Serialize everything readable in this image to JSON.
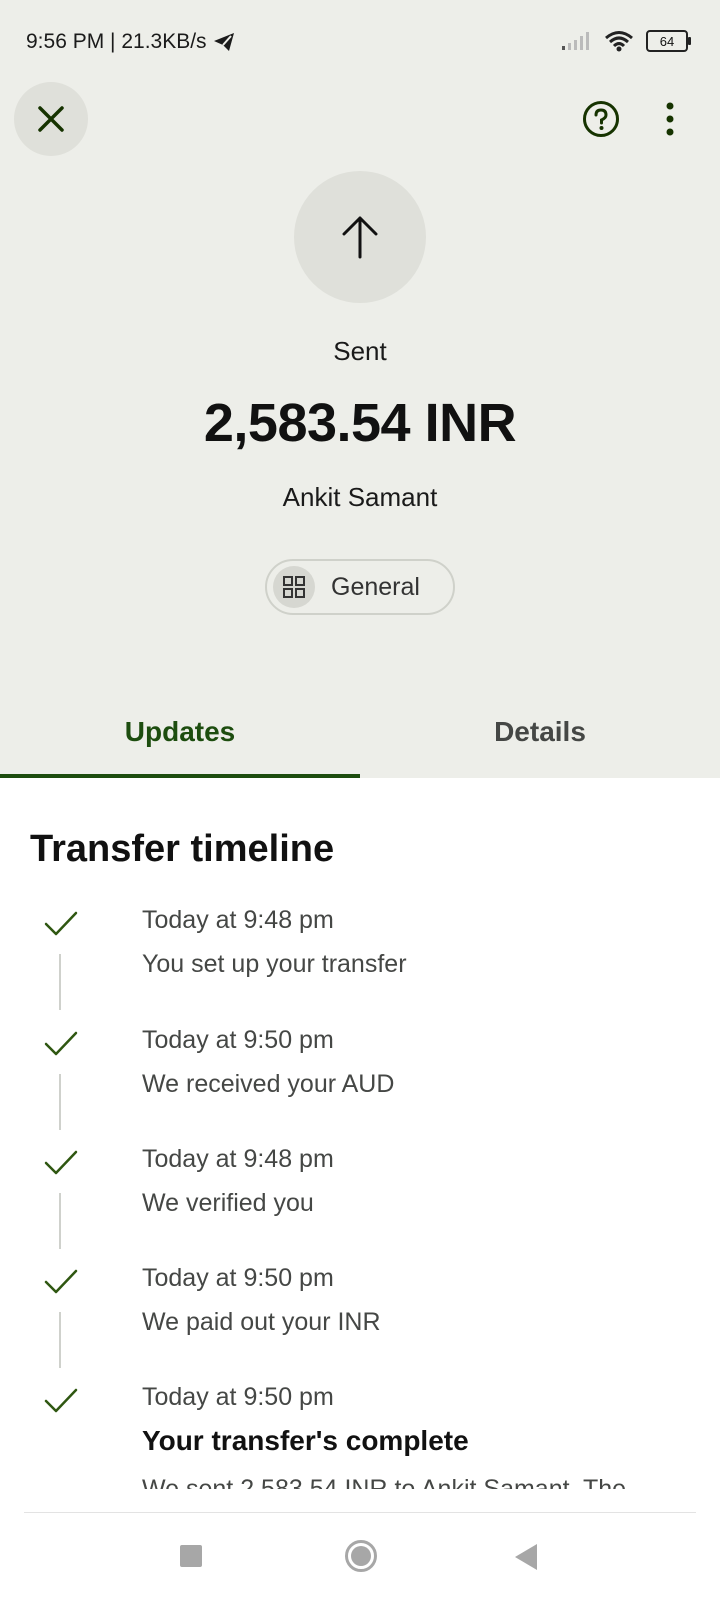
{
  "status_bar": {
    "time_speed": "9:56 PM | 21.3KB/s",
    "battery": "64",
    "icons": [
      "telegram-icon",
      "signal-icon",
      "wifi-icon",
      "battery-icon"
    ]
  },
  "header": {
    "icons": [
      "close-icon",
      "help-icon",
      "more-vert-icon"
    ]
  },
  "transfer": {
    "direction_icon": "arrow-up-icon",
    "status": "Sent",
    "amount": "2,583.54 INR",
    "recipient": "Ankit Samant",
    "category": "General",
    "category_icon": "grid-icon"
  },
  "tabs": [
    {
      "label": "Updates",
      "active": true
    },
    {
      "label": "Details",
      "active": false
    }
  ],
  "timeline": {
    "title": "Transfer timeline",
    "items": [
      {
        "time": "Today at 9:48 pm",
        "text": "You set up your transfer"
      },
      {
        "time": "Today at 9:50 pm",
        "text": "We received your AUD"
      },
      {
        "time": "Today at 9:48 pm",
        "text": "We verified you"
      },
      {
        "time": "Today at 9:50 pm",
        "text": "We paid out your INR"
      },
      {
        "time": "Today at 9:50 pm",
        "text": "Your transfer's complete",
        "detail": "We sent 2,583.54 INR to Ankit Samant. The"
      }
    ]
  },
  "colors": {
    "accent": "#1d4d0f",
    "header_bg": "#edeee9",
    "circle_bg": "#dfe0da"
  }
}
